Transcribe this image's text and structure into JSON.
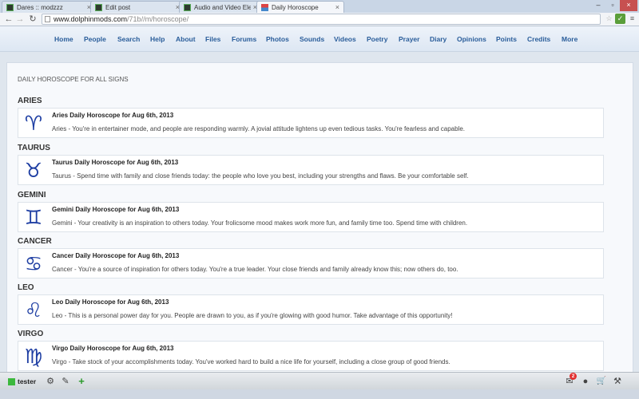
{
  "browser": {
    "tabs": [
      {
        "label": "Dares :: modzzz",
        "favicon": "dolphinmods-favicon"
      },
      {
        "label": "Edit post",
        "favicon": "dolphinmods-favicon"
      },
      {
        "label": "Audio and Video Electroni",
        "favicon": "dolphinmods-favicon"
      },
      {
        "label": "Daily Horoscope",
        "favicon": "horoscope-favicon"
      }
    ],
    "url_host": "www.dolphinmods.com",
    "url_path": "/71b//m/horoscope/"
  },
  "nav": [
    "Home",
    "People",
    "Search",
    "Help",
    "About",
    "Files",
    "Forums",
    "Photos",
    "Sounds",
    "Videos",
    "Poetry",
    "Prayer",
    "Diary",
    "Opinions",
    "Points",
    "Credits",
    "More"
  ],
  "page": {
    "title": "DAILY HOROSCOPE FOR ALL SIGNS",
    "signs": [
      {
        "name": "ARIES",
        "glyph": "♈",
        "title": "Aries Daily Horoscope for Aug 6th, 2013",
        "text": "Aries - You're in entertainer mode, and people are responding warmly. A jovial attitude lightens up even tedious tasks. You're fearless and capable."
      },
      {
        "name": "TAURUS",
        "glyph": "♉",
        "title": "Taurus Daily Horoscope for Aug 6th, 2013",
        "text": "Taurus - Spend time with family and close friends today: the people who love you best, including your strengths and flaws. Be your comfortable self."
      },
      {
        "name": "GEMINI",
        "glyph": "♊",
        "title": "Gemini Daily Horoscope for Aug 6th, 2013",
        "text": "Gemini - Your creativity is an inspiration to others today. Your frolicsome mood makes work more fun, and family time too. Spend time with children."
      },
      {
        "name": "CANCER",
        "glyph": "♋",
        "title": "Cancer Daily Horoscope for Aug 6th, 2013",
        "text": "Cancer - You're a source of inspiration for others today. You're a true leader. Your close friends and family already know this; now others do, too."
      },
      {
        "name": "LEO",
        "glyph": "♌",
        "title": "Leo Daily Horoscope for Aug 6th, 2013",
        "text": "Leo - This is a personal power day for you. People are drawn to you, as if you're glowing with good humor. Take advantage of this opportunity!"
      },
      {
        "name": "VIRGO",
        "glyph": "♍",
        "title": "Virgo Daily Horoscope for Aug 6th, 2013",
        "text": "Virgo - Take stock of your accomplishments today. You've worked hard to build a nice life for yourself, including a close group of good friends."
      }
    ]
  },
  "toolbar": {
    "username": "tester",
    "mail_count": "2",
    "icons": [
      "gear-icon",
      "edit-icon",
      "plus-icon",
      "mail-icon",
      "person-icon",
      "cart-icon",
      "wrench-icon"
    ]
  },
  "colors": {
    "link": "#2a5d9a",
    "glyph": "#1f3fa3",
    "online": "#3cb83c",
    "badge": "#e23030"
  }
}
